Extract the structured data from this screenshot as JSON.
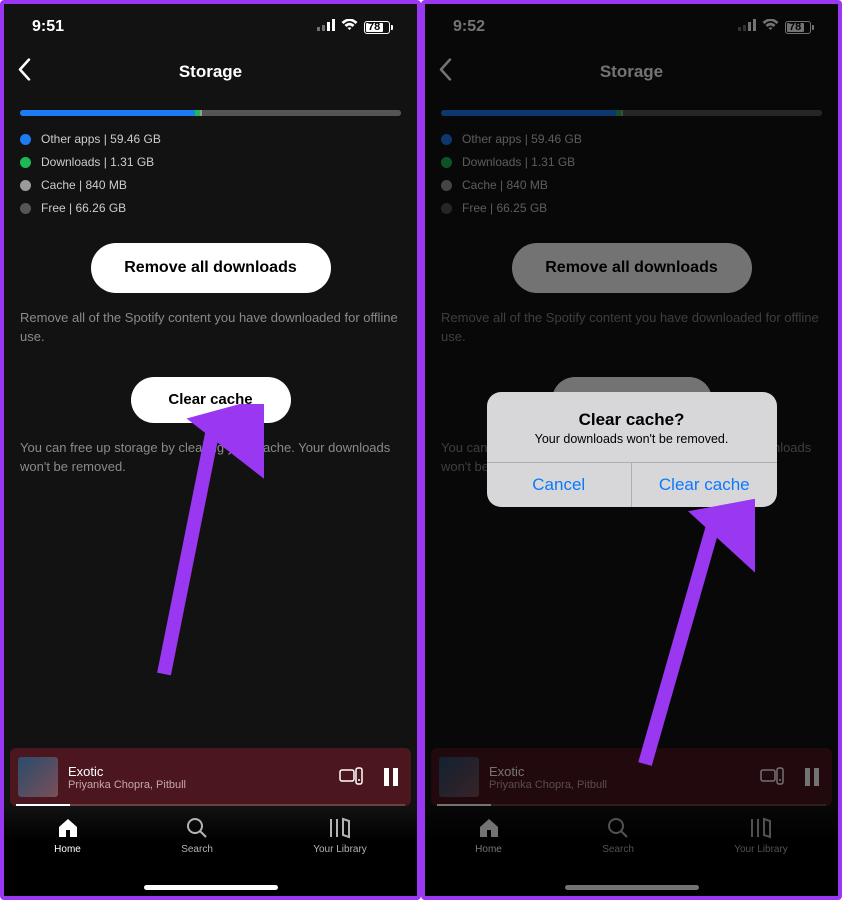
{
  "left": {
    "status": {
      "time": "9:51",
      "battery": "78"
    },
    "header": {
      "title": "Storage"
    },
    "bar": {
      "segments": [
        {
          "color": "#1e7cf2",
          "pct": 46
        },
        {
          "color": "#1db954",
          "pct": 1.2
        },
        {
          "color": "#9a9a9a",
          "pct": 0.7
        },
        {
          "color": "#555555",
          "pct": 52.1
        }
      ]
    },
    "legend": {
      "other_apps": {
        "color": "#1e7cf2",
        "label": "Other apps | 59.46 GB"
      },
      "downloads": {
        "color": "#1db954",
        "label": "Downloads | 1.31 GB"
      },
      "cache": {
        "color": "#9a9a9a",
        "label": "Cache | 840 MB"
      },
      "free": {
        "color": "#555555",
        "label": "Free | 66.26 GB"
      }
    },
    "buttons": {
      "remove_downloads": "Remove all downloads",
      "clear_cache": "Clear cache"
    },
    "helpers": {
      "downloads": "Remove all of the Spotify content you have downloaded for offline use.",
      "cache": "You can free up storage by clearing your cache. Your downloads won't be removed."
    },
    "now_playing": {
      "title": "Exotic",
      "artist": "Priyanka Chopra, Pitbull"
    },
    "nav": {
      "home": "Home",
      "search": "Search",
      "library": "Your Library"
    }
  },
  "right": {
    "status": {
      "time": "9:52",
      "battery": "78"
    },
    "header": {
      "title": "Storage"
    },
    "bar": {
      "segments": [
        {
          "color": "#1e7cf2",
          "pct": 46
        },
        {
          "color": "#1db954",
          "pct": 1.2
        },
        {
          "color": "#9a9a9a",
          "pct": 0.7
        },
        {
          "color": "#555555",
          "pct": 52.1
        }
      ]
    },
    "legend": {
      "other_apps": {
        "color": "#1e7cf2",
        "label": "Other apps | 59.46 GB"
      },
      "downloads": {
        "color": "#1db954",
        "label": "Downloads | 1.31 GB"
      },
      "cache": {
        "color": "#9a9a9a",
        "label": "Cache | 840 MB"
      },
      "free": {
        "color": "#555555",
        "label": "Free | 66.25 GB"
      }
    },
    "buttons": {
      "remove_downloads": "Remove all downloads",
      "clear_cache": "Clear cache"
    },
    "helpers": {
      "downloads": "Remove all of the Spotify content you have downloaded for offline use.",
      "cache": "You can free up storage by clearing your cache. Your downloads won't be removed."
    },
    "dialog": {
      "title": "Clear cache?",
      "message": "Your downloads won't be removed.",
      "cancel": "Cancel",
      "confirm": "Clear cache"
    },
    "now_playing": {
      "title": "Exotic",
      "artist": "Priyanka Chopra, Pitbull"
    },
    "nav": {
      "home": "Home",
      "search": "Search",
      "library": "Your Library"
    }
  },
  "arrow_color": "#9a37f0"
}
